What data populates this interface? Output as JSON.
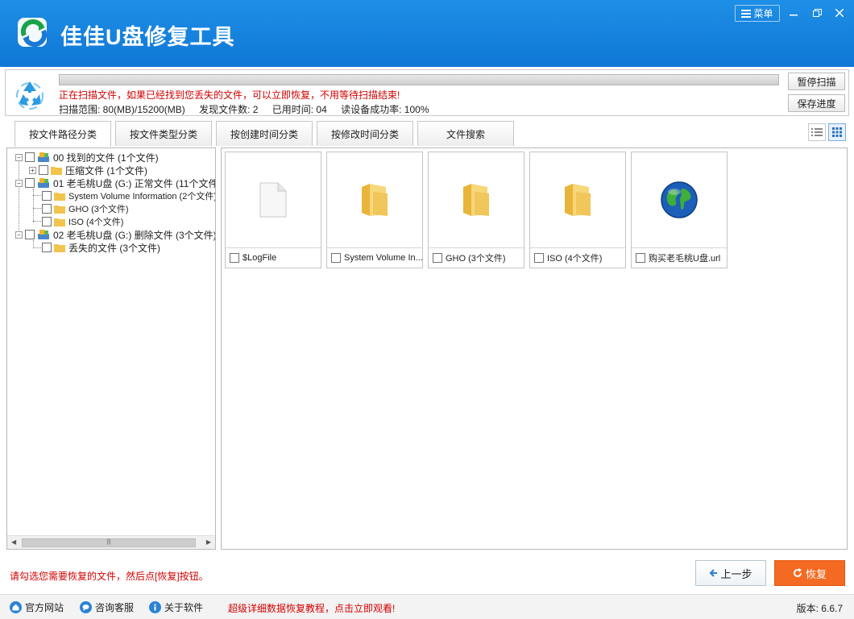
{
  "app": {
    "title": "佳佳U盘修复工具",
    "menu_label": "菜单"
  },
  "scan": {
    "message": "正在扫描文件，如果已经找到您丢失的文件，可以立即恢复，不用等待扫描结束!",
    "range": "扫描范围: 80(MB)/15200(MB)",
    "found": "发现文件数: 2",
    "elapsed": "已用时间: 04",
    "success_rate": "读设备成功率: 100%",
    "pause_label": "暂停扫描",
    "save_label": "保存进度"
  },
  "tabs": [
    {
      "label": "按文件路径分类"
    },
    {
      "label": "按文件类型分类"
    },
    {
      "label": "按创建时间分类"
    },
    {
      "label": "按修改时间分类"
    },
    {
      "label": "文件搜索"
    }
  ],
  "tree": [
    {
      "label": "00 找到的文件 (1个文件)"
    },
    {
      "label": "压缩文件    (1个文件)"
    },
    {
      "label": "01 老毛桃U盘 (G:) 正常文件 (11个文件)"
    },
    {
      "label": "System Volume Information    (2个文件)"
    },
    {
      "label": "GHO    (3个文件)"
    },
    {
      "label": "ISO    (4个文件)"
    },
    {
      "label": "02 老毛桃U盘 (G:) 删除文件 (3个文件)"
    },
    {
      "label": "丢失的文件    (3个文件)"
    }
  ],
  "files": [
    {
      "name": "$LogFile",
      "icon": "file-icon"
    },
    {
      "name": "System Volume In...",
      "icon": "folder-icon"
    },
    {
      "name": "GHO  (3个文件)",
      "icon": "folder-icon"
    },
    {
      "name": "ISO  (4个文件)",
      "icon": "folder-icon"
    },
    {
      "name": "购买老毛桃U盘.url",
      "icon": "globe-icon"
    }
  ],
  "hint": "请勾选您需要恢复的文件，然后点[恢复]按钮。",
  "buttons": {
    "back": "上一步",
    "recover": "恢复"
  },
  "status": {
    "official_site": "官方网站",
    "support": "咨询客服",
    "about": "关于软件",
    "promo": "超级详细数据恢复教程，点击立即观看!",
    "version": "版本: 6.6.7"
  }
}
